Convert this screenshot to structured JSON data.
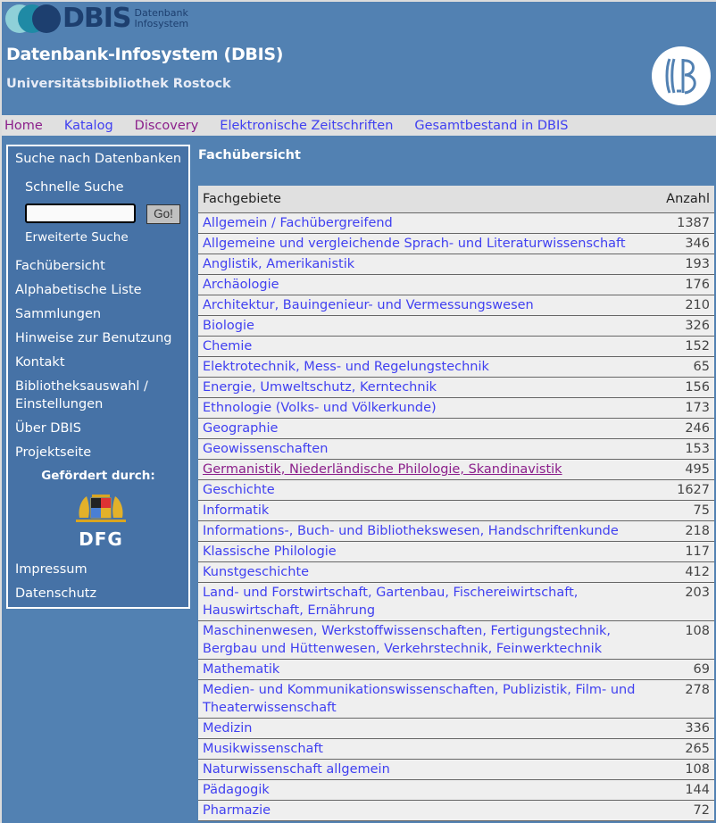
{
  "header": {
    "logo_text": "DBIS",
    "logo_sub_line1": "Datenbank",
    "logo_sub_line2": "Infosystem",
    "title": "Datenbank-Infosystem (DBIS)",
    "subtitle": "Universitätsbibliothek Rostock"
  },
  "nav": {
    "items": [
      {
        "label": "Home"
      },
      {
        "label": "Katalog"
      },
      {
        "label": "Discovery"
      },
      {
        "label": "Elektronische Zeitschriften"
      },
      {
        "label": "Gesamtbestand in DBIS"
      }
    ]
  },
  "sidebar": {
    "heading": "Suche nach Datenbanken",
    "quick_search_label": "Schnelle Suche",
    "search_value": "",
    "go_label": "Go!",
    "advanced_search": "Erweiterte Suche",
    "items": [
      {
        "label": "Fachübersicht"
      },
      {
        "label": "Alphabetische Liste"
      },
      {
        "label": "Sammlungen"
      },
      {
        "label": "Hinweise zur Benutzung"
      },
      {
        "label": "Kontakt"
      },
      {
        "label": "Bibliotheksauswahl / Einstellungen"
      },
      {
        "label": "Über DBIS"
      },
      {
        "label": "Projektseite"
      }
    ],
    "funded_by": "Gefördert durch:",
    "dfg_label": "DFG",
    "bottom_items": [
      {
        "label": "Impressum"
      },
      {
        "label": "Datenschutz"
      }
    ]
  },
  "main": {
    "title": "Fachübersicht",
    "table": {
      "headers": {
        "subject": "Fachgebiete",
        "count": "Anzahl"
      },
      "rows": [
        {
          "subject": "Allgemein / Fachübergreifend",
          "count": "1387"
        },
        {
          "subject": "Allgemeine und vergleichende Sprach- und Literaturwissenschaft",
          "count": "346"
        },
        {
          "subject": "Anglistik, Amerikanistik",
          "count": "193"
        },
        {
          "subject": "Archäologie",
          "count": "176"
        },
        {
          "subject": "Architektur, Bauingenieur- und Vermessungswesen",
          "count": "210"
        },
        {
          "subject": "Biologie",
          "count": "326"
        },
        {
          "subject": "Chemie",
          "count": "152"
        },
        {
          "subject": "Elektrotechnik, Mess- und Regelungstechnik",
          "count": "65"
        },
        {
          "subject": "Energie, Umweltschutz, Kerntechnik",
          "count": "156"
        },
        {
          "subject": "Ethnologie (Volks- und Völkerkunde)",
          "count": "173"
        },
        {
          "subject": "Geographie",
          "count": "246"
        },
        {
          "subject": "Geowissenschaften",
          "count": "153"
        },
        {
          "subject": "Germanistik, Niederländische Philologie, Skandinavistik",
          "count": "495",
          "visited": true
        },
        {
          "subject": "Geschichte",
          "count": "1627"
        },
        {
          "subject": "Informatik",
          "count": "75"
        },
        {
          "subject": "Informations-, Buch- und Bibliothekswesen, Handschriftenkunde",
          "count": "218"
        },
        {
          "subject": "Klassische Philologie",
          "count": "117"
        },
        {
          "subject": "Kunstgeschichte",
          "count": "412"
        },
        {
          "subject": "Land- und Forstwirtschaft, Gartenbau, Fischereiwirtschaft, Hauswirtschaft, Ernährung",
          "count": "203"
        },
        {
          "subject": "Maschinenwesen, Werkstoffwissenschaften, Fertigungstechnik, Bergbau und Hüttenwesen, Verkehrstechnik, Feinwerktechnik",
          "count": "108"
        },
        {
          "subject": "Mathematik",
          "count": "69"
        },
        {
          "subject": "Medien- und Kommunikationswissenschaften, Publizistik, Film- und Theaterwissenschaft",
          "count": "278"
        },
        {
          "subject": "Medizin",
          "count": "336"
        },
        {
          "subject": "Musikwissenschaft",
          "count": "265"
        },
        {
          "subject": "Naturwissenschaft allgemein",
          "count": "108"
        },
        {
          "subject": "Pädagogik",
          "count": "144"
        },
        {
          "subject": "Pharmazie",
          "count": "72"
        }
      ]
    }
  },
  "colors": {
    "background": "#5281b2",
    "sidebar": "#4672a6",
    "link": "#4040f0",
    "visited_link": "#8b1f8b",
    "navbar": "#e0e0e0"
  }
}
